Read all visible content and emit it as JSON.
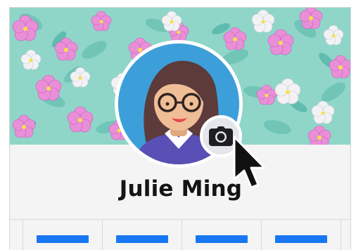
{
  "profile": {
    "name": "Julie Ming"
  },
  "nav": {
    "items": [
      {
        "icon": "nav-placeholder"
      },
      {
        "icon": "nav-placeholder"
      },
      {
        "icon": "nav-placeholder"
      },
      {
        "icon": "nav-placeholder"
      }
    ]
  },
  "icons": {
    "camera": "camera-icon",
    "cursor": "pointer-cursor"
  },
  "colors": {
    "accent": "#1877f2",
    "avatar_background": "#3d9fd9",
    "cover_base": "#7fcfc4",
    "flower_pink": "#e77bd4"
  }
}
